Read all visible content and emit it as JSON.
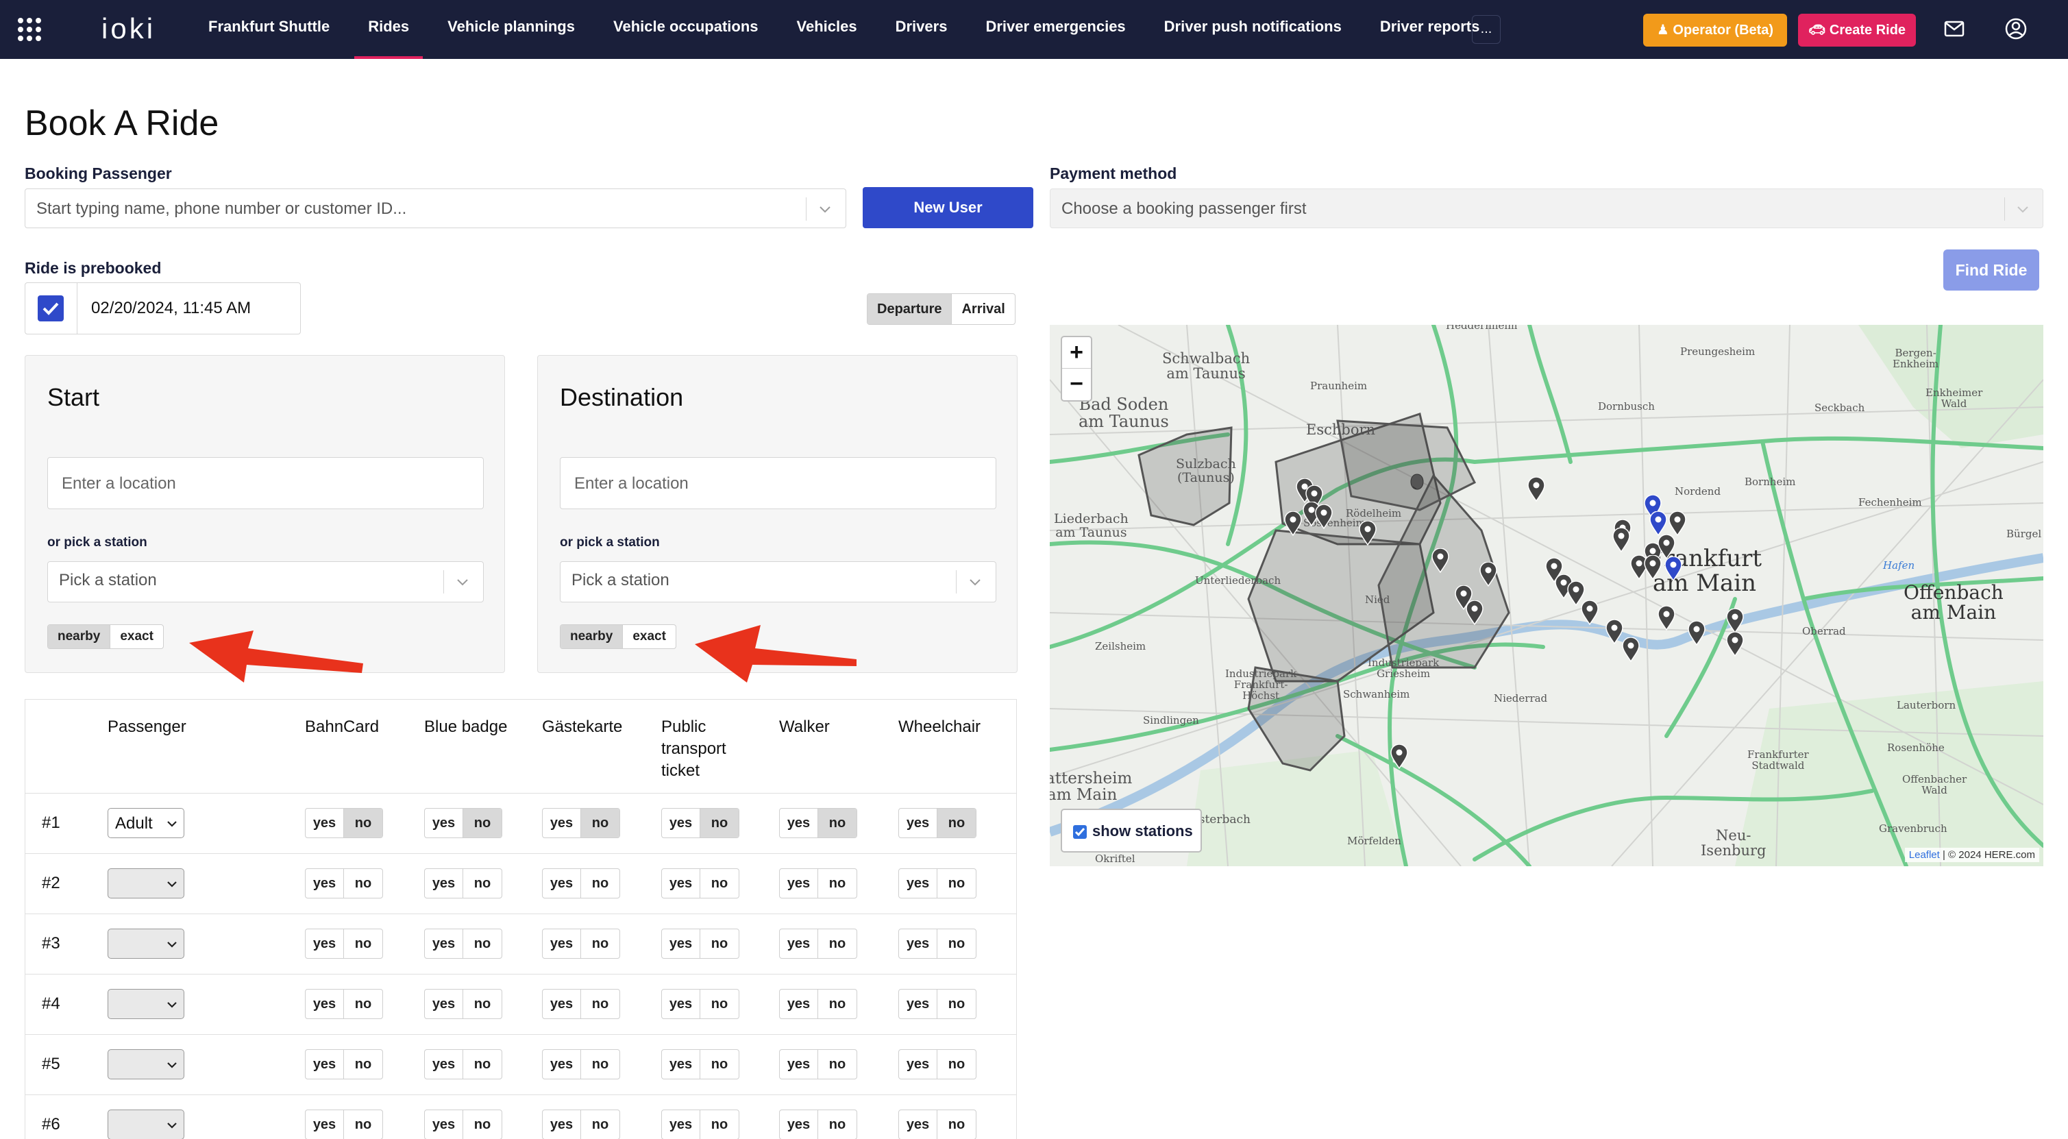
{
  "nav": {
    "brand": "Frankfurt Shuttle",
    "items": [
      "Rides",
      "Vehicle plannings",
      "Vehicle occupations",
      "Vehicles",
      "Drivers",
      "Driver emergencies",
      "Driver push notifications",
      "Driver reports"
    ],
    "more": "...",
    "operator_button": "Operator (Beta)",
    "create_button": "Create Ride",
    "logo": "ioki",
    "icons": [
      "apps-grid-icon",
      "mail-icon",
      "user-account-icon"
    ]
  },
  "page": {
    "title": "Book A Ride"
  },
  "booking": {
    "label": "Booking Passenger",
    "placeholder": "Start typing name, phone number or customer ID...",
    "new_user": "New User"
  },
  "payment": {
    "label": "Payment method",
    "placeholder": "Choose a booking passenger first"
  },
  "find_ride": "Find Ride",
  "prebook": {
    "label": "Ride is prebooked",
    "checked": true,
    "datetime": "02/20/2024, 11:45 AM"
  },
  "time_mode": {
    "options": [
      "Departure",
      "Arrival"
    ],
    "selected": "Departure"
  },
  "start": {
    "title": "Start",
    "placeholder": "Enter a location",
    "pick_label": "or pick a station",
    "station_placeholder": "Pick a station",
    "modes": [
      "nearby",
      "exact"
    ],
    "selected": "nearby"
  },
  "destination": {
    "title": "Destination",
    "placeholder": "Enter a location",
    "pick_label": "or pick a station",
    "station_placeholder": "Pick a station",
    "modes": [
      "nearby",
      "exact"
    ],
    "selected": "nearby"
  },
  "passengers": {
    "columns": [
      "Passenger",
      "BahnCard",
      "Blue badge",
      "Gästekarte",
      "Public transport ticket",
      "Walker",
      "Wheelchair"
    ],
    "column_lines": [
      [
        "Passenger"
      ],
      [
        "BahnCard"
      ],
      [
        "Blue badge"
      ],
      [
        "Gästekarte"
      ],
      [
        "Public",
        "transport",
        "ticket"
      ],
      [
        "Walker"
      ],
      [
        "Wheelchair"
      ]
    ],
    "yes": "yes",
    "no": "no",
    "rows": [
      {
        "num": "#1",
        "type": "Adult",
        "selected": "no"
      },
      {
        "num": "#2",
        "type": "",
        "selected": ""
      },
      {
        "num": "#3",
        "type": "",
        "selected": ""
      },
      {
        "num": "#4",
        "type": "",
        "selected": ""
      },
      {
        "num": "#5",
        "type": "",
        "selected": ""
      },
      {
        "num": "#6",
        "type": "",
        "selected": ""
      }
    ]
  },
  "map": {
    "zoom_in": "+",
    "zoom_out": "−",
    "show_stations": "show stations",
    "attribution_leaflet": "Leaflet",
    "attribution_rest": " | © 2024 HERE.com",
    "places": [
      {
        "name": "Heddernheim"
      },
      {
        "name": "Schwalbach\nam Taunus"
      },
      {
        "name": "Preungesheim"
      },
      {
        "name": "Bergen-\nEnkheim"
      },
      {
        "name": "Bad Soden\nam Taunus"
      },
      {
        "name": "Praunheim"
      },
      {
        "name": "Eschborn"
      },
      {
        "name": "Dornbusch"
      },
      {
        "name": "Seckbach"
      },
      {
        "name": "Enkheimer\nWald"
      },
      {
        "name": "Sulzbach\n(Taunus)"
      },
      {
        "name": "Bornheim"
      },
      {
        "name": "Nordend"
      },
      {
        "name": "Rödelheim"
      },
      {
        "name": "Liederbach\nam Taunus"
      },
      {
        "name": "Sossenheim"
      },
      {
        "name": "Fechenheim"
      },
      {
        "name": "Frankfurt\nam Main"
      },
      {
        "name": "Oberrad"
      },
      {
        "name": "Offenbach\nam Main"
      },
      {
        "name": "Unterliederbach"
      },
      {
        "name": "Nied"
      },
      {
        "name": "Zeilsheim"
      },
      {
        "name": "Industriepark\nGriesheim"
      },
      {
        "name": "Industriepark\nFrankfurt-\nHöchst"
      },
      {
        "name": "Schwanheim"
      },
      {
        "name": "Niederrad"
      },
      {
        "name": "Sindlingen"
      },
      {
        "name": "Lauterborn"
      },
      {
        "name": "Rosenhöhe"
      },
      {
        "name": "Frankfurter\nStadtwald"
      },
      {
        "name": "Offenbacher\nWald"
      },
      {
        "name": "Hattersheim\nam Main"
      },
      {
        "name": "Kelsterbach"
      },
      {
        "name": "Neu-\nIsenburg"
      },
      {
        "name": "Gravenbruch"
      },
      {
        "name": "Mörfelden"
      },
      {
        "name": "Okriftel"
      },
      {
        "name": "Hafen"
      },
      {
        "name": "Bürgel"
      }
    ]
  },
  "colors": {
    "nav_bg": "#1a1f3a",
    "accent_pink": "#e0225e",
    "operator_orange": "#f29a1a",
    "primary_blue": "#2f49c9",
    "arrow_red": "#e8321c"
  }
}
